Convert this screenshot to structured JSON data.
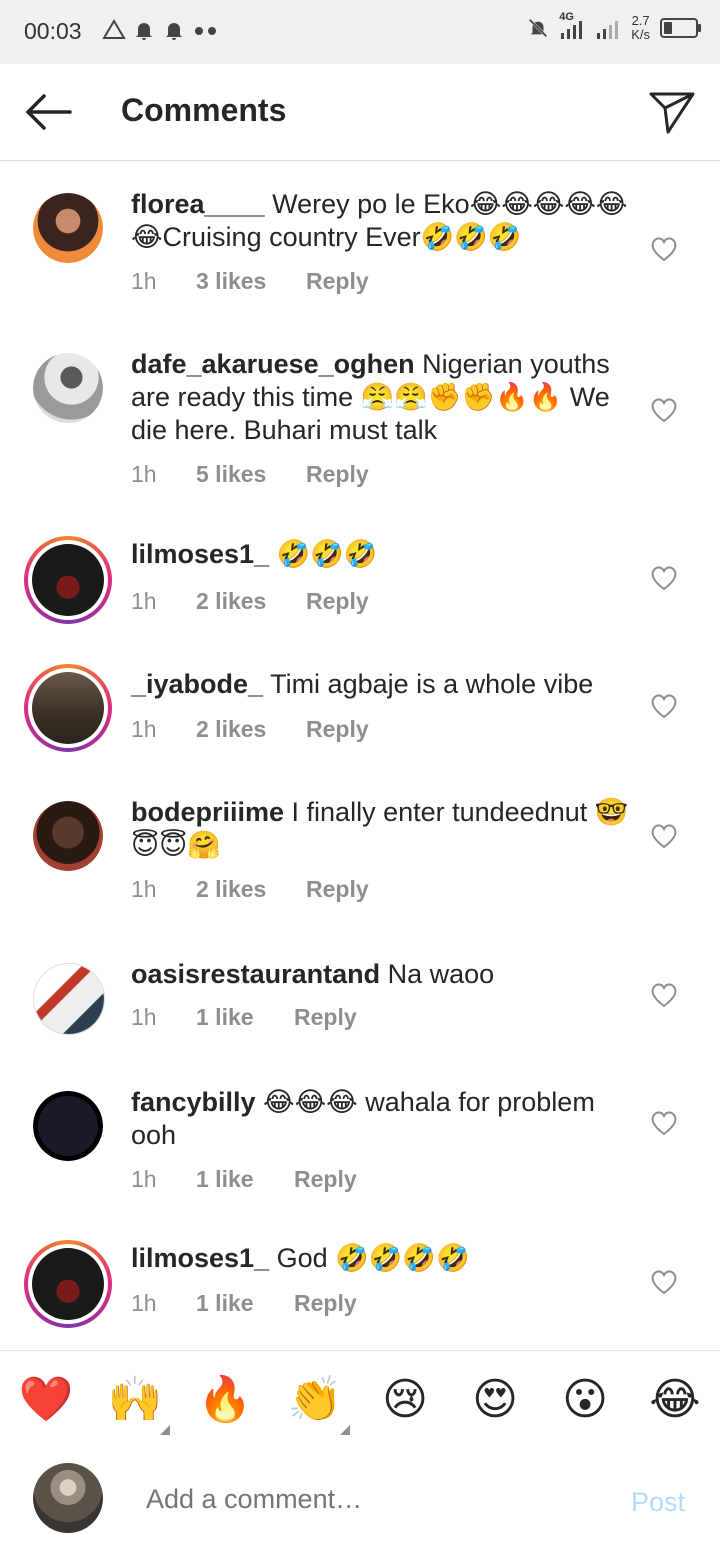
{
  "status_bar": {
    "time": "00:03",
    "left_icons": [
      "warning-triangle-icon",
      "bell-icon",
      "bell-icon",
      "dots-icon"
    ],
    "network": "4G",
    "speed_value": "2.7",
    "speed_unit": "K/s"
  },
  "header": {
    "title": "Comments"
  },
  "comments": [
    {
      "username": "florea____",
      "text": " Werey po le Eko😂😂😂😂😂😂Cruising country Ever🤣🤣🤣",
      "time": "1h",
      "likes": "3 likes",
      "reply": "Reply",
      "story_ring": false
    },
    {
      "username": "dafe_akaruese_oghen",
      "text": " Nigerian youths are ready this time 😤😤✊✊🔥🔥 We die here. Buhari must talk",
      "time": "1h",
      "likes": "5 likes",
      "reply": "Reply",
      "story_ring": false
    },
    {
      "username": "lilmoses1_",
      "text": " 🤣🤣🤣",
      "time": "1h",
      "likes": "2 likes",
      "reply": "Reply",
      "story_ring": true
    },
    {
      "username": "_iyabode_",
      "text": " Timi agbaje is a whole vibe",
      "time": "1h",
      "likes": "2 likes",
      "reply": "Reply",
      "story_ring": true
    },
    {
      "username": "bodepriiime",
      "text": " I finally enter tundeednut 🤓😇😇🤗",
      "time": "1h",
      "likes": "2 likes",
      "reply": "Reply",
      "story_ring": false
    },
    {
      "username": "oasisrestaurantand",
      "text": " Na waoo",
      "time": "1h",
      "likes": "1 like",
      "reply": "Reply",
      "story_ring": false
    },
    {
      "username": "fancybilly",
      "text": " 😂😂😂 wahala for problem ooh",
      "time": "1h",
      "likes": "1 like",
      "reply": "Reply",
      "story_ring": false
    },
    {
      "username": "lilmoses1_",
      "text": " God 🤣🤣🤣🤣",
      "time": "1h",
      "likes": "1 like",
      "reply": "Reply",
      "story_ring": true
    }
  ],
  "quick_reactions": [
    "❤️",
    "🙌",
    "🔥",
    "👏",
    "😢",
    "😍",
    "😮",
    "😂"
  ],
  "composer": {
    "placeholder": "Add a comment…",
    "post_label": "Post"
  },
  "colors": {
    "accent_disabled": "#b3dbff",
    "muted": "#8e8e8e",
    "text": "#262626"
  }
}
